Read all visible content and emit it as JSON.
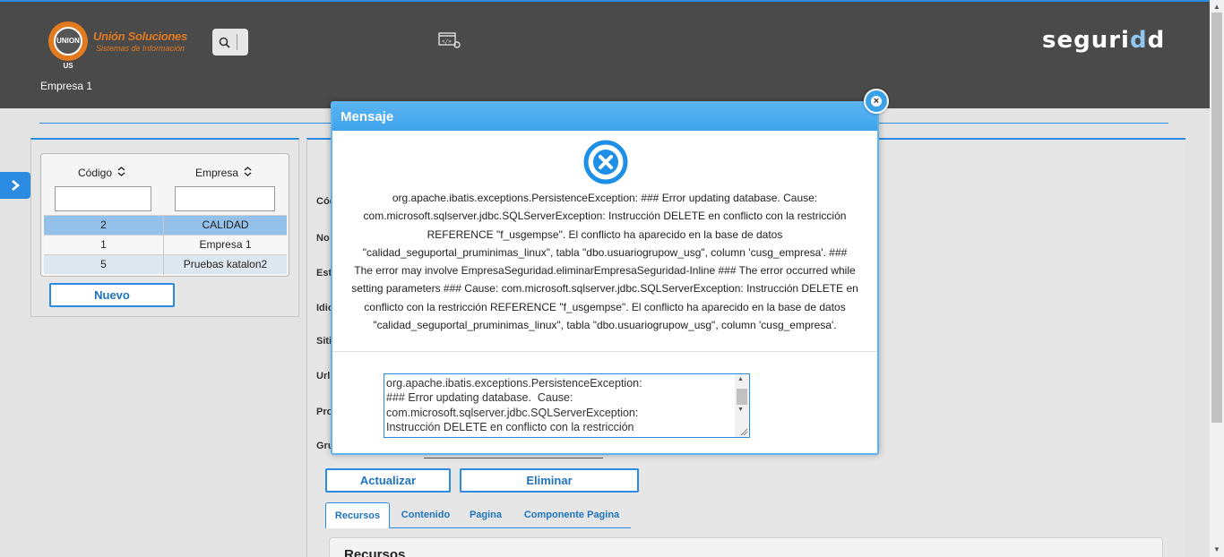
{
  "header": {
    "logo_mark": "UNION US",
    "logo_title": "Unión Soluciones",
    "logo_subtitle": "Sistemas de Información",
    "brand_left": "seguri",
    "brand_d": "d",
    "brand_right": "d",
    "company": "Empresa 1"
  },
  "table": {
    "col_codigo": "Código",
    "col_empresa": "Empresa",
    "rows": [
      {
        "codigo": "2",
        "empresa": "CALIDAD",
        "selected": true
      },
      {
        "codigo": "1",
        "empresa": "Empresa 1",
        "selected": false
      },
      {
        "codigo": "5",
        "empresa": "Pruebas katalon2",
        "selected": false
      }
    ],
    "new_button": "Nuevo"
  },
  "form": {
    "labels": [
      "Cód",
      "No",
      "Est",
      "Idio",
      "Siti",
      "Url",
      "Pro",
      "Gru"
    ],
    "update_button": "Actualizar",
    "delete_button": "Eliminar",
    "tabs": [
      "Recursos",
      "Contenido",
      "Pagina",
      "Componente Pagina"
    ],
    "section_title": "Recursos"
  },
  "modal": {
    "title": "Mensaje",
    "message_lines": [
      "org.apache.ibatis.exceptions.PersistenceException: ### Error updating database. Cause:",
      "com.microsoft.sqlserver.jdbc.SQLServerException: Instrucción DELETE en conflicto con la restricción",
      "REFERENCE \"f_usgempse\". El conflicto ha aparecido en la base de datos",
      "\"calidad_seguportal_pruminimas_linux\", tabla \"dbo.usuariogrupow_usg\", column 'cusg_empresa'. ###",
      "The error may involve EmpresaSeguridad.eliminarEmpresaSeguridad-Inline ### The error occurred while",
      "setting parameters ### Cause: com.microsoft.sqlserver.jdbc.SQLServerException: Instrucción DELETE en",
      "conflicto con la restricción REFERENCE \"f_usgempse\". El conflicto ha aparecido en la base de datos",
      "\"calidad_seguportal_pruminimas_linux\", tabla \"dbo.usuariogrupow_usg\", column 'cusg_empresa'."
    ],
    "detail_text": "org.apache.ibatis.exceptions.PersistenceException: \n### Error updating database.  Cause: \ncom.microsoft.sqlserver.jdbc.SQLServerException: \nInstrucción DELETE en conflicto con la restricción",
    "close_label": "×"
  },
  "colors": {
    "accent": "#2a8be0",
    "header_bg": "#4a4a4a",
    "logo_orange": "#e27a1f",
    "error_blue": "#1e8fe6"
  },
  "icons": [
    "search-icon",
    "code-settings-icon",
    "chevron-right-icon",
    "error-x-icon",
    "close-icon",
    "sort-icon"
  ]
}
